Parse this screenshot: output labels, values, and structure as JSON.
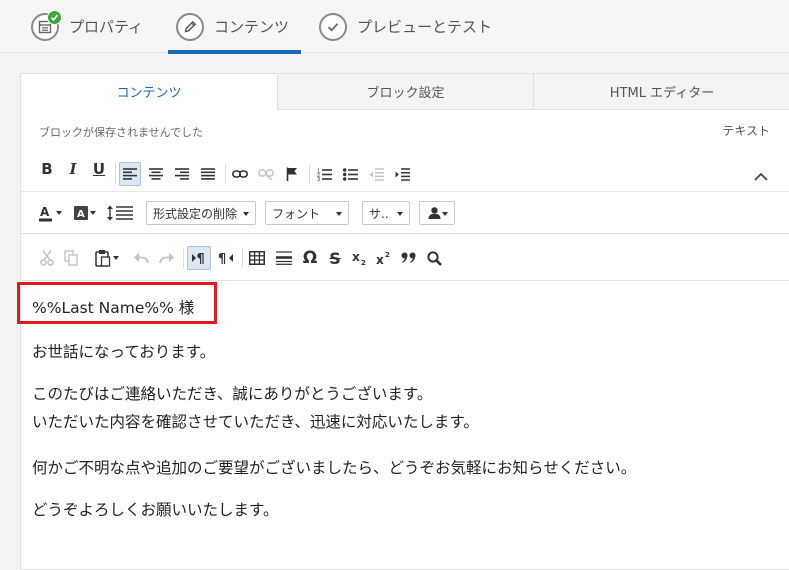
{
  "wizard": {
    "tabs": [
      {
        "label": "プロパティ",
        "icon": "properties-icon",
        "completed": true
      },
      {
        "label": "コンテンツ",
        "icon": "pencil-icon",
        "active": true
      },
      {
        "label": "プレビューとテスト",
        "icon": "check-circle-icon"
      }
    ]
  },
  "panel": {
    "tabs": [
      {
        "label": "コンテンツ",
        "active": true
      },
      {
        "label": "ブロック設定"
      },
      {
        "label": "HTML エディター"
      }
    ],
    "status_message": "ブロックが保存されませんでした",
    "mode_label": "テキスト"
  },
  "toolbar": {
    "row1": [
      "bold-icon",
      "italic-icon",
      "underline-icon",
      "align-left-icon",
      "align-center-icon",
      "align-right-icon",
      "align-justify-icon",
      "link-icon",
      "unlink-icon",
      "anchor-flag-icon",
      "numbered-list-icon",
      "bulleted-list-icon",
      "outdent-icon",
      "indent-icon",
      "collapse-toolbar-icon"
    ],
    "row2": {
      "font_color_icon": "font-color-icon",
      "background_color_icon": "background-color-icon",
      "line_height_icon": "line-height-icon",
      "format_clear_label": "形式設定の削除",
      "font_label": "フォント",
      "size_label": "サ..",
      "personalize_icon": "personalize-user-icon"
    },
    "row3": [
      "cut-icon",
      "copy-icon",
      "paste-icon",
      "undo-icon",
      "redo-icon",
      "ltr-paragraph-icon",
      "rtl-paragraph-icon",
      "table-icon",
      "horizontal-rule-icon",
      "special-character-icon",
      "strikethrough-icon",
      "subscript-icon",
      "superscript-icon",
      "blockquote-icon",
      "find-icon"
    ]
  },
  "content": {
    "greeting": "%%Last Name%% 様",
    "p1": "お世話になっております。",
    "p2_line1": "このたびはご連絡いただき、誠にありがとうございます。",
    "p2_line2": "いただいた内容を確認させていただき、迅速に対応いたします。",
    "p3": "何かご不明な点や追加のご要望がございましたら、どうぞお気軽にお知らせください。",
    "p4": "どうぞよろしくお願いいたします。"
  },
  "colors": {
    "accent": "#1a67b5",
    "highlight_border": "#e4171d",
    "completed_badge": "#3aa83a"
  }
}
